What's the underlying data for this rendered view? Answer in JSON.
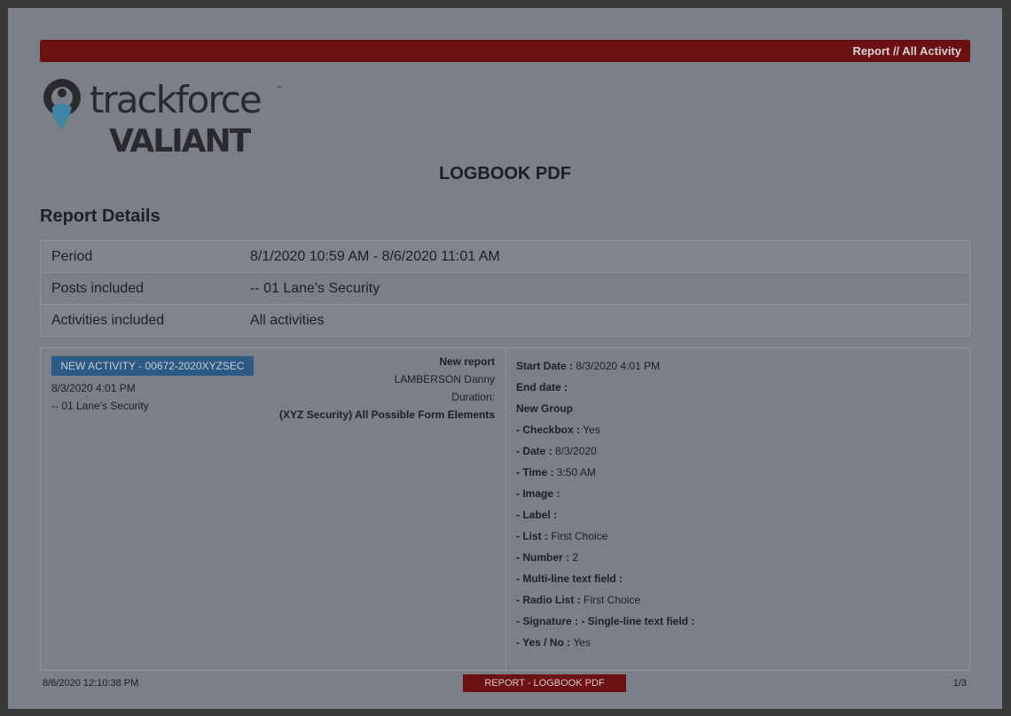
{
  "header": {
    "breadcrumb": "Report // All Activity"
  },
  "logo": {
    "line1": "trackforce",
    "line2": "VALIANT",
    "tm": "™"
  },
  "document": {
    "title": "LOGBOOK PDF"
  },
  "report_details": {
    "heading": "Report Details",
    "rows": [
      {
        "label": "Period",
        "value": "8/1/2020 10:59 AM - 8/6/2020 11:01 AM"
      },
      {
        "label": "Posts included",
        "value": "-- 01 Lane's Security"
      },
      {
        "label": "Activities included",
        "value": "All activities"
      }
    ]
  },
  "activity": {
    "badge": "NEW ACTIVITY - 00672-2020XYZSEC",
    "datetime": "8/3/2020 4:01 PM",
    "post": "-- 01 Lane's Security",
    "type": "New report",
    "officer": "LAMBERSON Danny",
    "duration": "Duration:",
    "form_name": "(XYZ Security) All Possible Form Elements",
    "fields": [
      {
        "label": "Start Date :",
        "value": " 8/3/2020 4:01 PM"
      },
      {
        "label": "End date :",
        "value": ""
      },
      {
        "label": "New Group",
        "value": ""
      },
      {
        "label": "- Checkbox :",
        "value": " Yes"
      },
      {
        "label": "- Date :",
        "value": " 8/3/2020"
      },
      {
        "label": "- Time :",
        "value": " 3:50 AM"
      },
      {
        "label": "- Image :",
        "value": ""
      },
      {
        "label": "- Label :",
        "value": ""
      },
      {
        "label": "- List :",
        "value": " First Choice"
      },
      {
        "label": "- Number :",
        "value": " 2"
      },
      {
        "label": "- Multi-line text field :",
        "value": ""
      },
      {
        "label": "- Radio List :",
        "value": " First Choice"
      },
      {
        "label": "- Signature : - Single-line text field :",
        "value": ""
      },
      {
        "label": "- Yes / No :",
        "value": " Yes"
      }
    ]
  },
  "footer": {
    "timestamp": "8/6/2020 12:10:38 PM",
    "label": "REPORT - LOGBOOK PDF",
    "page": "1/3"
  },
  "colors": {
    "brand_red": "#6b1114",
    "badge_blue": "#2d5a83",
    "logo_teal": "#3d86a6",
    "logo_dark": "#2a2a2e"
  }
}
